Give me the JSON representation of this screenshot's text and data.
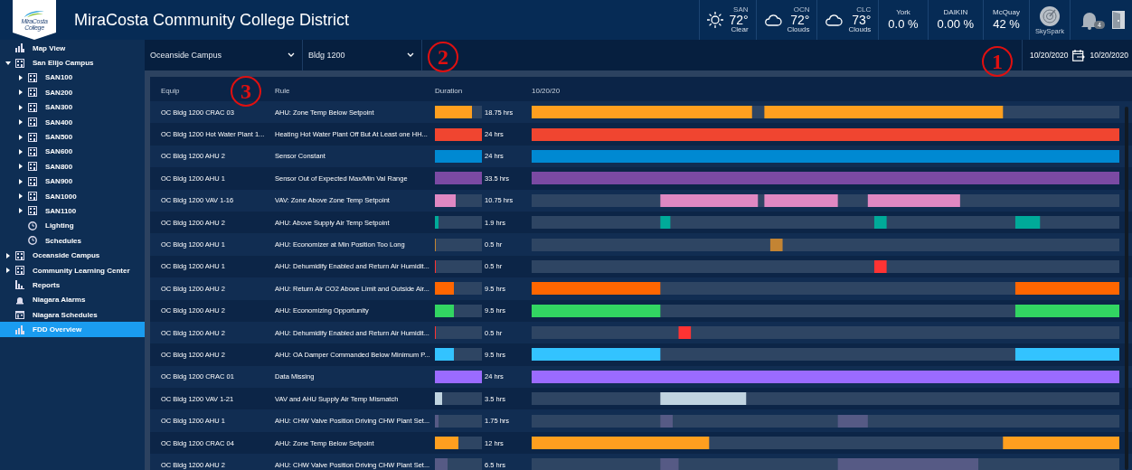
{
  "header": {
    "logo_text": [
      "MiraCosta",
      "College"
    ],
    "title": "MiraCosta Community College District",
    "weather": [
      {
        "kind": "sun",
        "code": "SAN",
        "temp": "72°",
        "condition": "Clear"
      },
      {
        "kind": "cloud",
        "code": "OCN",
        "temp": "72°",
        "condition": "Clouds"
      },
      {
        "kind": "cloud",
        "code": "CLC",
        "temp": "73°",
        "condition": "Clouds"
      }
    ],
    "stats": [
      {
        "label": "York",
        "value": "0.0 %"
      },
      {
        "label": "DAIKIN",
        "value": "0.00 %"
      },
      {
        "label": "McQuay",
        "value": "42 %"
      }
    ],
    "skyspark": "SkySpark",
    "notifications": "4"
  },
  "sidebar": {
    "items": [
      {
        "label": "Map View",
        "kind": "chart",
        "selected": false
      },
      {
        "label": "San Elijo Campus",
        "kind": "building",
        "selected": false,
        "expanded": true,
        "children": [
          {
            "label": "SAN100",
            "kind": "building",
            "selected": false,
            "expanded": false
          },
          {
            "label": "SAN200",
            "kind": "building",
            "selected": false,
            "expanded": false
          },
          {
            "label": "SAN300",
            "kind": "building",
            "selected": false,
            "expanded": false
          },
          {
            "label": "SAN400",
            "kind": "building",
            "selected": false,
            "expanded": false
          },
          {
            "label": "SAN500",
            "kind": "building",
            "selected": false,
            "expanded": false
          },
          {
            "label": "SAN600",
            "kind": "building",
            "selected": false,
            "expanded": false
          },
          {
            "label": "SAN800",
            "kind": "building",
            "selected": false,
            "expanded": false
          },
          {
            "label": "SAN900",
            "kind": "building",
            "selected": false,
            "expanded": false
          },
          {
            "label": "SAN1000",
            "kind": "building",
            "selected": false,
            "expanded": false
          },
          {
            "label": "SAN1100",
            "kind": "building",
            "selected": false,
            "expanded": false
          },
          {
            "label": "Lighting",
            "kind": "clock",
            "selected": false
          },
          {
            "label": "Schedules",
            "kind": "clock",
            "selected": false
          }
        ]
      },
      {
        "label": "Oceanside Campus",
        "kind": "building",
        "selected": false,
        "expanded": false
      },
      {
        "label": "Community Learning Center",
        "kind": "building",
        "selected": false,
        "expanded": false
      },
      {
        "label": "Reports",
        "kind": "bars",
        "selected": false
      },
      {
        "label": "Niagara Alarms",
        "kind": "alarm",
        "selected": false
      },
      {
        "label": "Niagara Schedules",
        "kind": "calendar",
        "selected": false
      },
      {
        "label": "FDD Overview",
        "kind": "chart",
        "selected": true
      }
    ]
  },
  "toolbar": {
    "campus": "Oceanside Campus",
    "building": "Bldg 1200",
    "date_from": "10/20/2020",
    "date_to": "10/20/2020"
  },
  "markers": [
    {
      "label": "2"
    },
    {
      "label": "1"
    },
    {
      "label": "3"
    }
  ],
  "table": {
    "columns": [
      "Equip",
      "Rule",
      "Duration",
      "10/20/20"
    ],
    "rows": [
      {
        "equip": "OC Bldg 1200 CRAC 03",
        "rule": "AHU: Zone Temp Below Setpoint",
        "level": 0.78,
        "duration": "18.75 hrs",
        "color": "#ff9f1f"
      },
      {
        "equip": "OC Bldg 1200 Hot Water Plant 1...",
        "rule": "Heating Hot Water Plant Off But At Least one HH...",
        "level": 1,
        "duration": "24 hrs",
        "color": "#f04530"
      },
      {
        "equip": "OC Bldg 1200 AHU 2",
        "rule": "Sensor Constant",
        "level": 1,
        "duration": "24 hrs",
        "color": "#0089d2"
      },
      {
        "equip": "OC Bldg 1200 AHU 1",
        "rule": "Sensor Out of Expected Max/Min Val Range",
        "level": 1,
        "duration": "33.5 hrs",
        "color": "#7b4aa3"
      },
      {
        "equip": "OC Bldg 1200 VAV 1-16",
        "rule": "VAV: Zone Above Zone Temp Setpoint",
        "level": 0.45,
        "duration": "10.75 hrs",
        "color": "#e088c2"
      },
      {
        "equip": "OC Bldg 1200 AHU 2",
        "rule": "AHU: Above Supply Air Temp Setpoint",
        "level": 0.08,
        "duration": "1.9 hrs",
        "color": "#00aa99"
      },
      {
        "equip": "OC Bldg 1200 AHU 1",
        "rule": "AHU: Economizer at Min Position Too Long",
        "level": 0.02,
        "duration": "0.5 hr",
        "color": "#c38433"
      },
      {
        "equip": "OC Bldg 1200 AHU 1",
        "rule": "AHU: Dehumidify Enabled and Return Air Humidit...",
        "level": 0.02,
        "duration": "0.5 hr",
        "color": "#ff3333"
      },
      {
        "equip": "OC Bldg 1200 AHU 2",
        "rule": "AHU: Return Air CO2 Above Limit and Outside Air...",
        "level": 0.4,
        "duration": "9.5 hrs",
        "color": "#ff6600"
      },
      {
        "equip": "OC Bldg 1200 AHU 2",
        "rule": "AHU: Economizing Opportunity",
        "level": 0.4,
        "duration": "9.5 hrs",
        "color": "#32d562"
      },
      {
        "equip": "OC Bldg 1200 AHU 2",
        "rule": "AHU: Dehumidify Enabled and Return Air Humidit...",
        "level": 0.02,
        "duration": "0.5 hr",
        "color": "#ff3333"
      },
      {
        "equip": "OC Bldg 1200 AHU 2",
        "rule": "AHU: OA Damper Commanded Below Minimum P...",
        "level": 0.4,
        "duration": "9.5 hrs",
        "color": "#33c3ff"
      },
      {
        "equip": "OC Bldg 1200 CRAC 01",
        "rule": "Data Missing",
        "level": 1,
        "duration": "24 hrs",
        "color": "#9b6bff"
      },
      {
        "equip": "OC Bldg 1200 VAV 1-21",
        "rule": "VAV and AHU Supply Air Temp Mismatch",
        "level": 0.15,
        "duration": "3.5 hrs",
        "color": "#c0d4e0"
      },
      {
        "equip": "OC Bldg 1200 AHU 1",
        "rule": "AHU: CHW Valve Position Driving CHW Plant Set...",
        "level": 0.07,
        "duration": "1.75 hrs",
        "color": "#565a85"
      },
      {
        "equip": "OC Bldg 1200 CRAC 04",
        "rule": "AHU: Zone Temp Below Setpoint",
        "level": 0.5,
        "duration": "12 hrs",
        "color": "#ff9f1f"
      },
      {
        "equip": "OC Bldg 1200 AHU 2",
        "rule": "AHU: CHW Valve Position Driving CHW Plant Set...",
        "level": 0.27,
        "duration": "6.5 hrs",
        "color": "#565a85"
      }
    ]
  }
}
